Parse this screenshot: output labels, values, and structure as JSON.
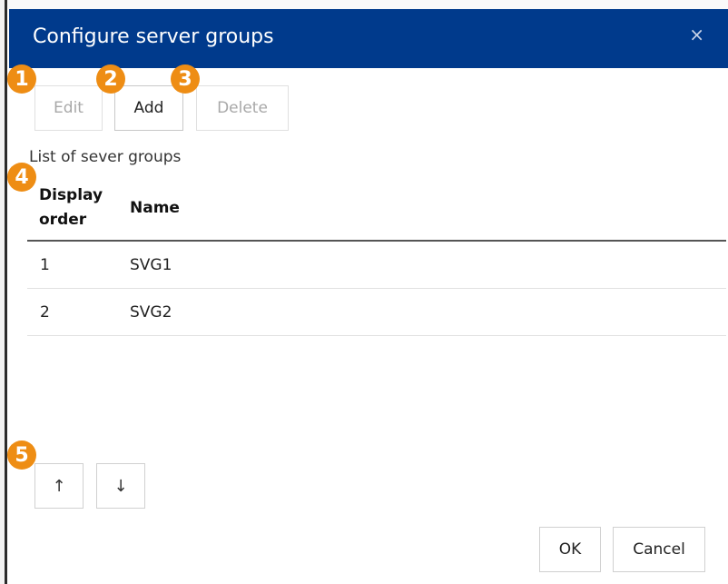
{
  "dialog": {
    "title": "Configure server groups",
    "close_glyph": "×"
  },
  "toolbar": {
    "edit_label": "Edit",
    "add_label": "Add",
    "delete_label": "Delete"
  },
  "list": {
    "label": "List of sever groups",
    "columns": [
      "Display order",
      "Name"
    ],
    "header_order_line1": "Display",
    "header_order_line2": "order",
    "header_name": "Name",
    "rows": [
      {
        "order": "1",
        "name": "SVG1"
      },
      {
        "order": "2",
        "name": "SVG2"
      }
    ]
  },
  "move": {
    "up_icon": "↑",
    "down_icon": "↓"
  },
  "footer": {
    "ok_label": "OK",
    "cancel_label": "Cancel"
  },
  "callouts": [
    "1",
    "2",
    "3",
    "4",
    "5"
  ],
  "colors": {
    "titlebar": "#003a8c",
    "callout": "#ee8d14"
  }
}
